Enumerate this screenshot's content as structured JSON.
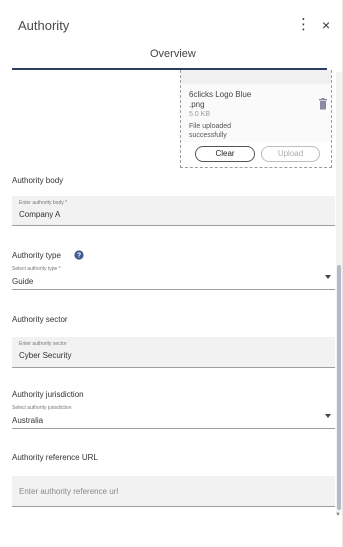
{
  "header": {
    "title": "Authority",
    "menu_glyph": "⋮",
    "close_glyph": "×"
  },
  "tabs": {
    "active": "Overview"
  },
  "upload": {
    "file_name": "6clicks Logo Blue .png",
    "file_size": "5.0 KB",
    "status": "File uploaded successfully",
    "clear_label": "Clear",
    "upload_label": "Upload",
    "delete_icon": "trash-icon"
  },
  "form": {
    "authority_body": {
      "label": "Authority body",
      "hint": "Enter authority body *",
      "value": "Company A"
    },
    "authority_type": {
      "label": "Authority type",
      "hint": "Select authority type *",
      "value": "Guide",
      "help_icon": "help-circle-icon"
    },
    "authority_sector": {
      "label": "Authority sector",
      "hint": "Enter authority sector",
      "value": "Cyber Security"
    },
    "authority_jurisdiction": {
      "label": "Authority jurisdiction",
      "hint": "Select authority jurisdiction",
      "value": "Australia"
    },
    "authority_reference_url": {
      "label": "Authority reference URL",
      "placeholder": "Enter authority reference url"
    }
  },
  "colors": {
    "tab_underline": "#2c3e63",
    "help_icon": "#3f5b8f",
    "field_fill": "#f2f2f2"
  }
}
